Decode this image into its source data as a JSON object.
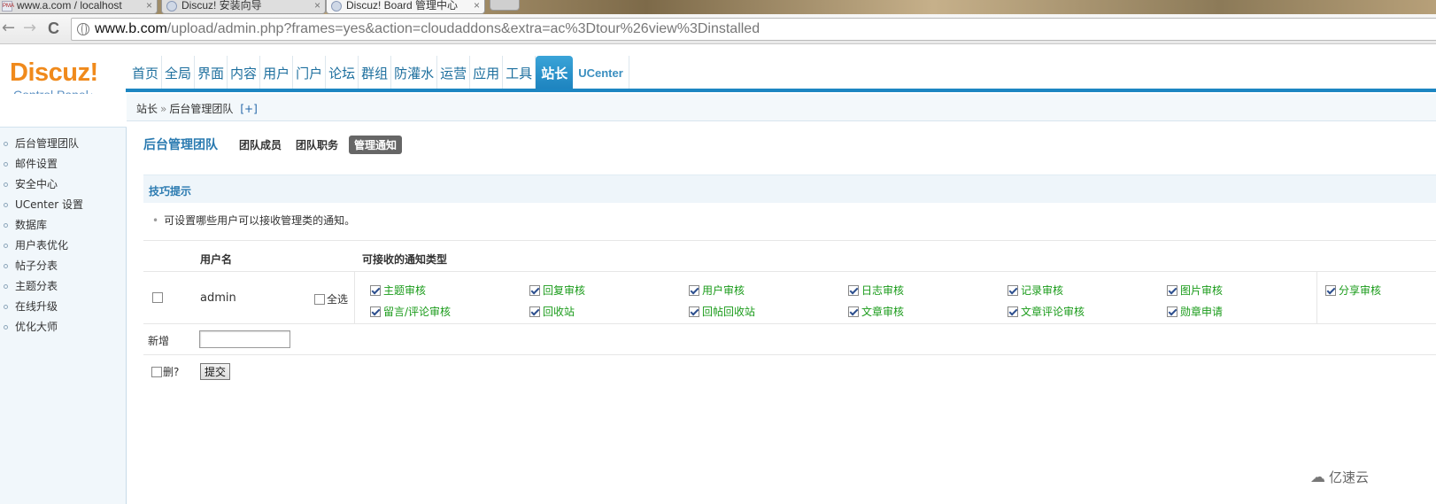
{
  "browser": {
    "tabs": [
      {
        "title": "www.a.com / localhost",
        "icon": "phpmyadmin-icon"
      },
      {
        "title": "Discuz! 安装向导",
        "icon": "globe-icon"
      },
      {
        "title": "Discuz! Board 管理中心",
        "icon": "globe-icon"
      }
    ],
    "tab_close": "×",
    "pma_label": "PMA",
    "url_host": "www.b.com",
    "url_path": "/upload/admin.php?frames=yes&action=cloudaddons&extra=ac%3Dtour%26view%3Dinstalled",
    "back_icon": "←",
    "forward_icon": "→",
    "reload_icon": "C"
  },
  "logo": {
    "name": "Discuz!",
    "sub": "Control Panel",
    "home_icon": "⌂"
  },
  "mainnav": [
    {
      "label": "首页"
    },
    {
      "label": "全局"
    },
    {
      "label": "界面"
    },
    {
      "label": "内容"
    },
    {
      "label": "用户"
    },
    {
      "label": "门户"
    },
    {
      "label": "论坛"
    },
    {
      "label": "群组"
    },
    {
      "label": "防灌水"
    },
    {
      "label": "运营"
    },
    {
      "label": "应用"
    },
    {
      "label": "工具"
    },
    {
      "label": "站长",
      "active": true
    },
    {
      "label": "UCenter"
    }
  ],
  "sidebar": {
    "items": [
      {
        "label": "后台管理团队"
      },
      {
        "label": "邮件设置"
      },
      {
        "label": "安全中心"
      },
      {
        "label": "UCenter 设置"
      },
      {
        "label": "数据库"
      },
      {
        "label": "用户表优化"
      },
      {
        "label": "帖子分表"
      },
      {
        "label": "主题分表"
      },
      {
        "label": "在线升级"
      },
      {
        "label": "优化大师"
      }
    ]
  },
  "breadcrumb": {
    "root": "站长",
    "sep": "»",
    "current": "后台管理团队",
    "plus": "[+]"
  },
  "subnav": {
    "title": "后台管理团队",
    "links": [
      {
        "label": "团队成员"
      },
      {
        "label": "团队职务"
      },
      {
        "label": "管理通知",
        "active": true
      }
    ]
  },
  "tips": {
    "heading": "技巧提示",
    "bullet": "•",
    "text": "可设置哪些用户可以接收管理类的通知。"
  },
  "table": {
    "col_username": "用户名",
    "col_notice": "可接收的通知类型",
    "row": {
      "username": "admin",
      "select_all": "全选",
      "notices_row1": [
        "主题审核",
        "回复审核",
        "用户审核",
        "日志审核",
        "记录审核",
        "图片审核",
        "分享审核"
      ],
      "notices_row2": [
        "留言/评论审核",
        "回收站",
        "回帖回收站",
        "文章审核",
        "文章评论审核",
        "勋章申请"
      ]
    },
    "add_label": "新增",
    "add_value": "",
    "delete_label": "删?",
    "submit_label": "提交"
  },
  "watermark": {
    "text": "亿速云",
    "icon": "cloud-logo-icon"
  }
}
